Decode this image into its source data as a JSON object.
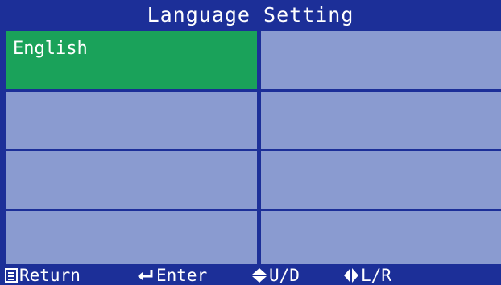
{
  "title": "Language Setting",
  "languages": [
    {
      "label": "English",
      "selected": true
    },
    {
      "label": "",
      "selected": false
    },
    {
      "label": "",
      "selected": false
    },
    {
      "label": "",
      "selected": false
    },
    {
      "label": "",
      "selected": false
    },
    {
      "label": "",
      "selected": false
    },
    {
      "label": "",
      "selected": false
    },
    {
      "label": "",
      "selected": false
    }
  ],
  "footer": {
    "return_label": "Return",
    "enter_label": "Enter",
    "ud_label": "U/D",
    "lr_label": "L/R",
    "return_icon": "return-icon",
    "enter_icon": "enter-icon",
    "ud_icon": "up-down-arrows-icon",
    "lr_icon": "left-right-arrows-icon"
  },
  "colors": {
    "background": "#1c2f98",
    "cell": "#8a9bd0",
    "selected": "#1aa25a",
    "text": "#ffffff"
  }
}
